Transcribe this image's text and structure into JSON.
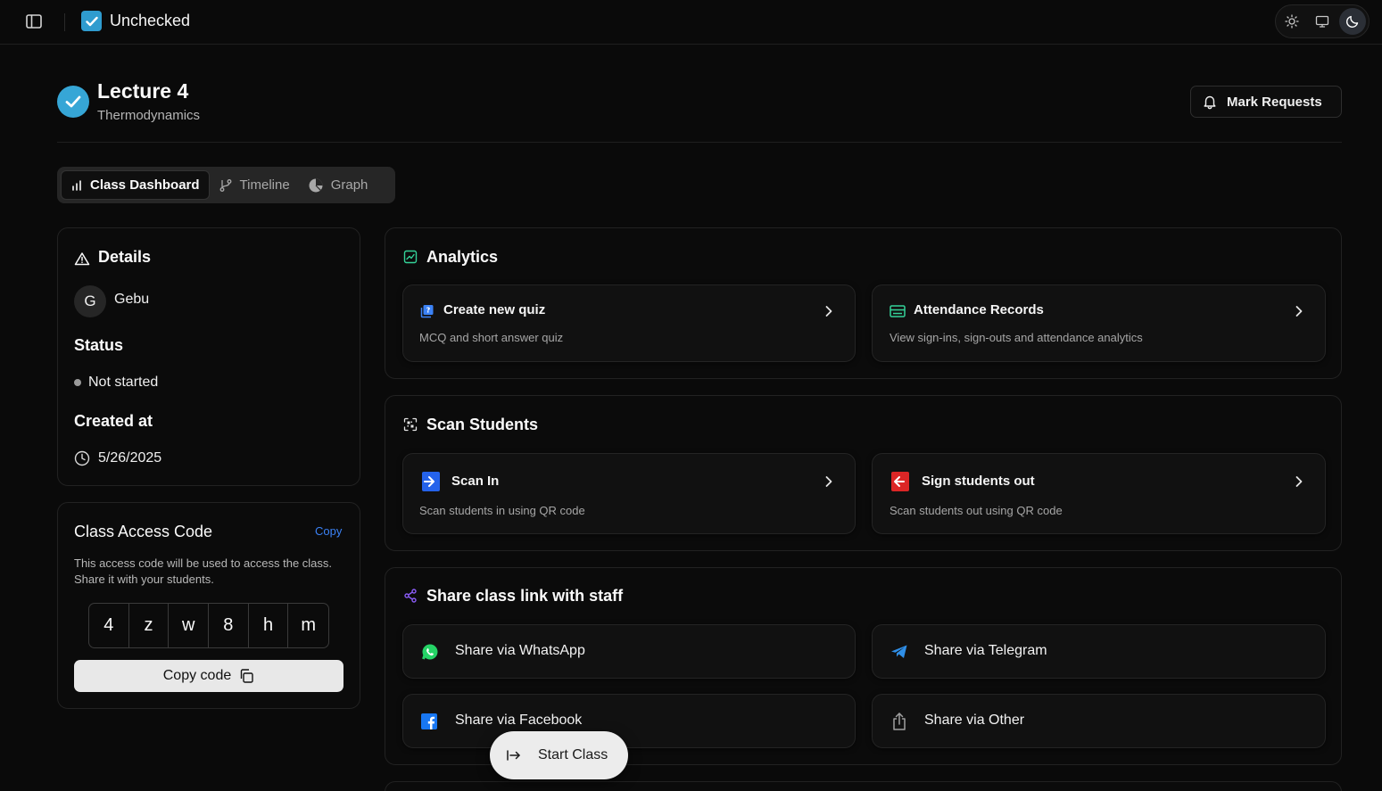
{
  "app": {
    "title": "Unchecked",
    "accent": "#2f9ccf"
  },
  "theme": {
    "options": [
      "light-icon",
      "system-icon",
      "dark-icon"
    ],
    "selected": "dark"
  },
  "lecture": {
    "title": "Lecture 4",
    "subtitle": "Thermodynamics",
    "mark_requests_label": "Mark Requests"
  },
  "tabs": [
    {
      "label": "Class Dashboard",
      "icon": "bar-chart-icon",
      "active": true
    },
    {
      "label": "Timeline",
      "icon": "git-branch-icon",
      "active": false
    },
    {
      "label": "Graph",
      "icon": "pie-chart-icon",
      "active": false
    }
  ],
  "details": {
    "heading": "Details",
    "owner_initial": "G",
    "owner_name": "Gebu",
    "status_heading": "Status",
    "status_value": "Not started",
    "created_heading": "Created at",
    "created_value": "5/26/2025"
  },
  "access_code": {
    "heading": "Class Access Code",
    "copy_link": "Copy",
    "description": "This access code will be used to access the class. Share it with your students.",
    "chars": [
      "4",
      "z",
      "w",
      "8",
      "h",
      "m"
    ],
    "copy_button": "Copy code"
  },
  "analytics": {
    "heading": "Analytics",
    "tiles": [
      {
        "title": "Create new quiz",
        "subtitle": "MCQ and short answer quiz",
        "icon": "quiz-icon"
      },
      {
        "title": "Attendance Records",
        "subtitle": "View sign-ins, sign-outs and attendance analytics",
        "icon": "records-icon"
      }
    ]
  },
  "scan": {
    "heading": "Scan Students",
    "tiles": [
      {
        "title": "Scan In",
        "subtitle": "Scan students in using QR code",
        "icon": "scan-in-icon"
      },
      {
        "title": "Sign students out",
        "subtitle": "Scan students out using QR code",
        "icon": "sign-out-icon"
      }
    ]
  },
  "share": {
    "heading": "Share class link with staff",
    "items": [
      {
        "label": "Share via WhatsApp",
        "icon": "whatsapp-icon",
        "color": "#25d366"
      },
      {
        "label": "Share via Telegram",
        "icon": "telegram-icon",
        "color": "#2f8fe8"
      },
      {
        "label": "Share via Facebook",
        "icon": "facebook-icon",
        "color": "#1877f2"
      },
      {
        "label": "Share via Other",
        "icon": "share-icon",
        "color": "#a0a0a0"
      }
    ]
  },
  "start_class": {
    "label": "Start Class"
  }
}
